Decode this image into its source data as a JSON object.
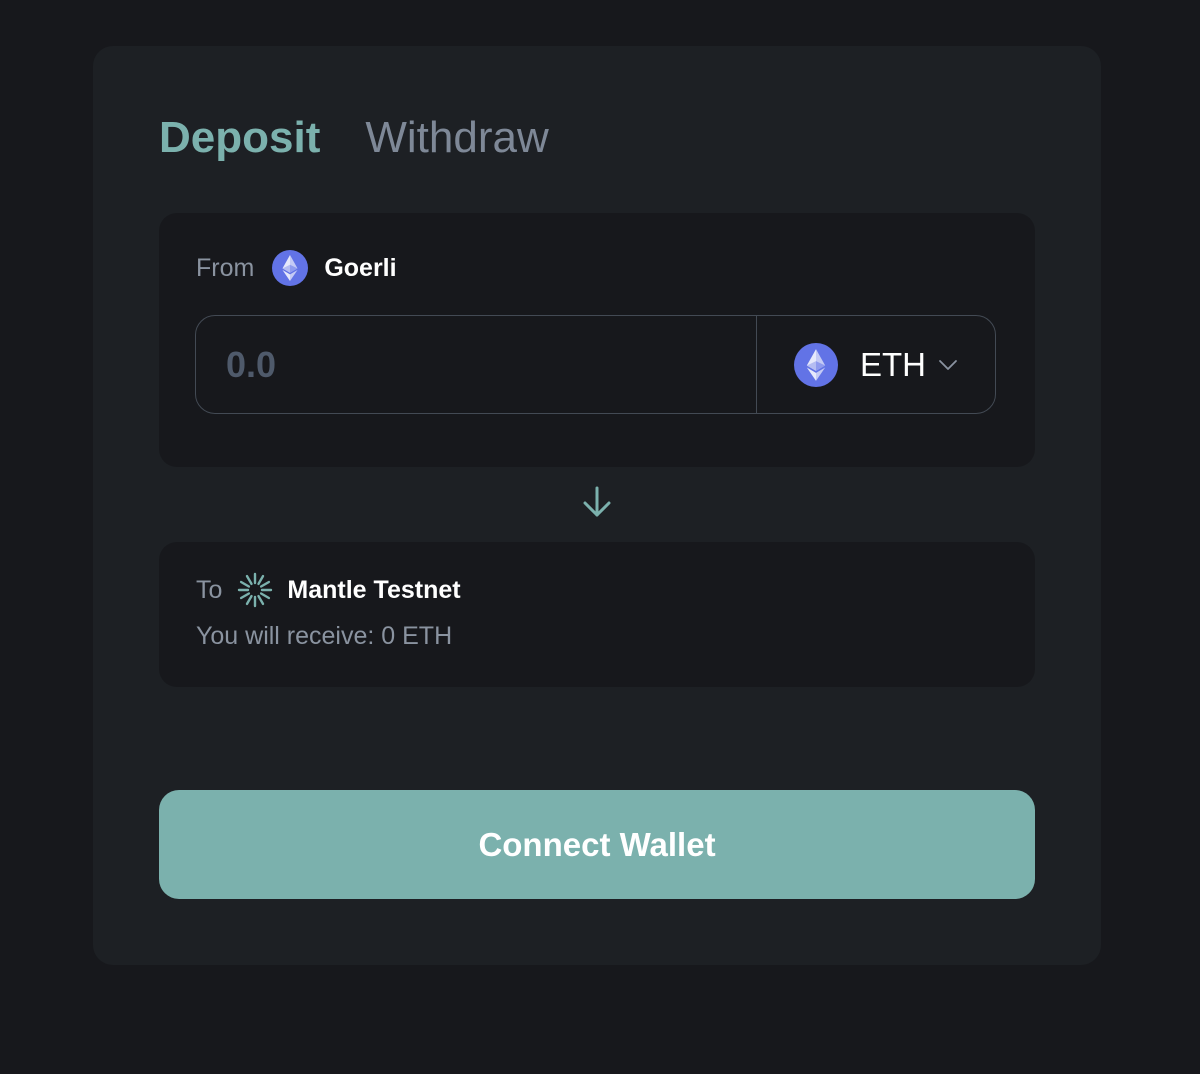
{
  "tabs": {
    "deposit_label": "Deposit",
    "withdraw_label": "Withdraw",
    "active": "Deposit"
  },
  "from": {
    "prefix": "From",
    "network_name": "Goerli",
    "network_icon": "ethereum-icon",
    "amount_value": "",
    "amount_placeholder": "0.0",
    "token_symbol": "ETH",
    "token_icon": "ethereum-icon"
  },
  "to": {
    "prefix": "To",
    "network_name": "Mantle Testnet",
    "network_icon": "mantle-icon",
    "receive_text": "You will receive: 0 ETH"
  },
  "connect_button_label": "Connect Wallet",
  "colors": {
    "page_background": "#17181c",
    "card_background": "#1d2024",
    "accent": "#7bb1ad",
    "ethereum_purple": "#6273e6",
    "muted_text": "#8a93a0"
  }
}
